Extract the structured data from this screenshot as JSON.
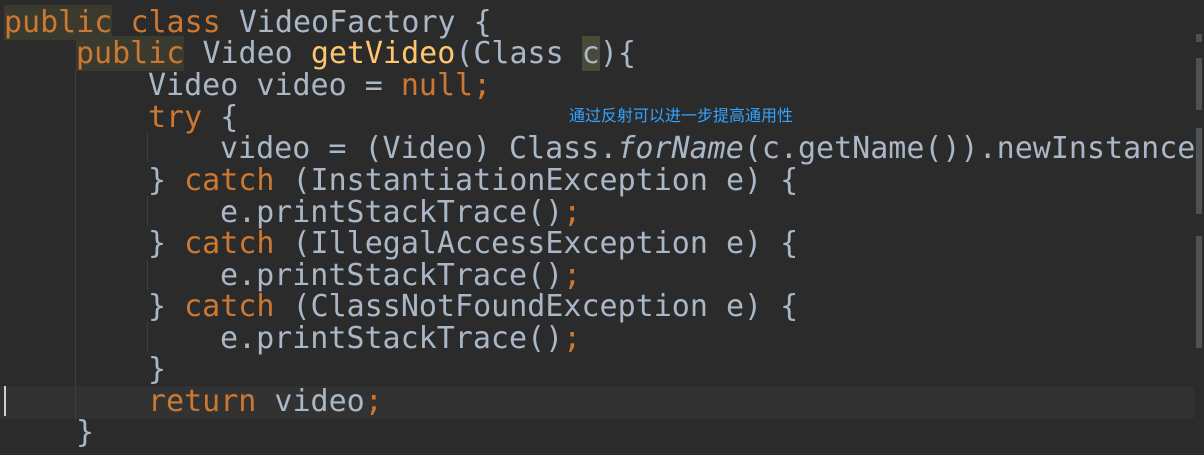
{
  "code": {
    "l1": {
      "public": "public",
      "class": "class",
      "name": "VideoFactory",
      "brace": "{"
    },
    "l2": {
      "public": "public",
      "type": "Video",
      "method": "getVideo",
      "paren_open": "(",
      "ptype": "Class",
      "param": "c",
      "paren_close": "){"
    },
    "l3": {
      "decl": "Video video = ",
      "null": "null",
      "semi": ";"
    },
    "l4": {
      "try": "try",
      "brace": " {"
    },
    "l5": {
      "pre": "video = (Video) Class.",
      "forName": "forName",
      "post": "(c.getName()).newInstance("
    },
    "l6": {
      "close": "} ",
      "catch": "catch",
      "rest": " (InstantiationException e) {"
    },
    "l7": {
      "call": "e.printStackTrace()",
      "semi": ";"
    },
    "l8": {
      "close": "} ",
      "catch": "catch",
      "rest": " (IllegalAccessException e) {"
    },
    "l9": {
      "call": "e.printStackTrace()",
      "semi": ";"
    },
    "l10": {
      "close": "} ",
      "catch": "catch",
      "rest": " (ClassNotFoundException e) {"
    },
    "l11": {
      "call": "e.printStackTrace()",
      "semi": ";"
    },
    "l12": {
      "brace": "}"
    },
    "l13": {
      "return": "return",
      "rest": " video",
      "semi": ";"
    },
    "l14": {
      "brace": "}"
    }
  },
  "subtitle": "通过反射可以进一步提高通用性",
  "colors": {
    "background": "#2b2b2b",
    "keyword": "#cc7832",
    "method": "#ffc66d",
    "text": "#a9b7c6",
    "subtitle": "#33a4ff"
  }
}
